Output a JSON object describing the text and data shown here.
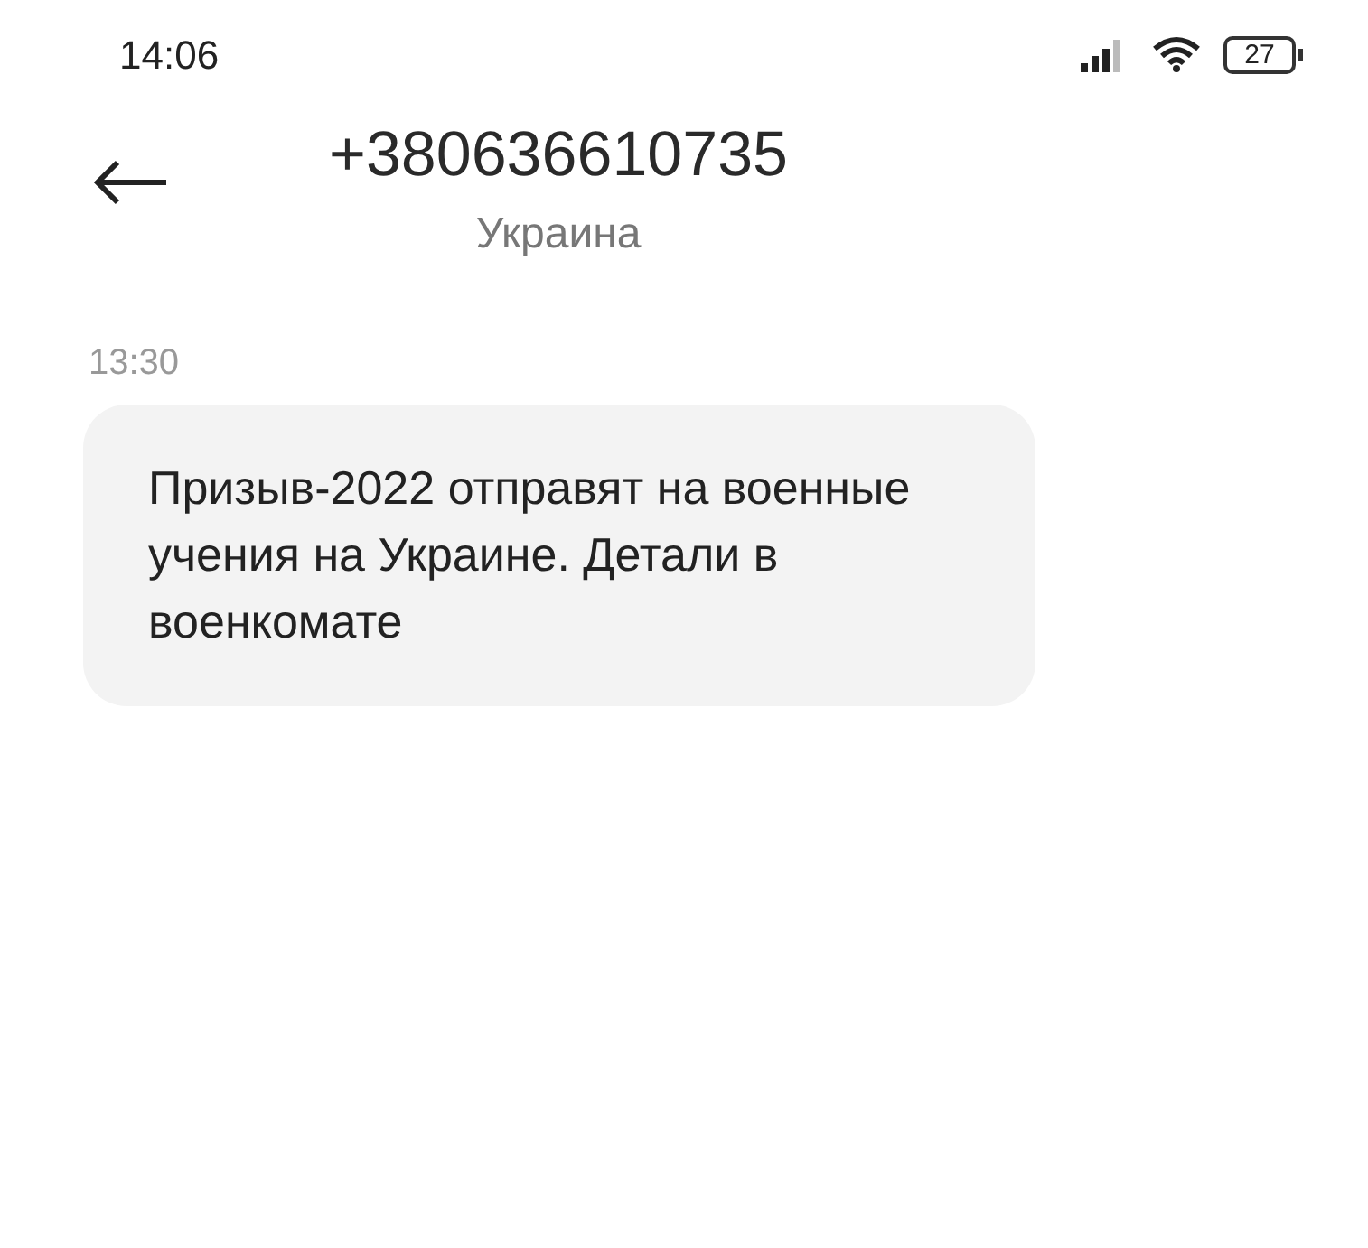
{
  "status_bar": {
    "time": "14:06",
    "battery": "27"
  },
  "header": {
    "title": "+380636610735",
    "subtitle": "Украина"
  },
  "messages": [
    {
      "time": "13:30",
      "text": "Призыв-2022 отправят на военные учения на Украине. Детали в военкомате"
    }
  ]
}
